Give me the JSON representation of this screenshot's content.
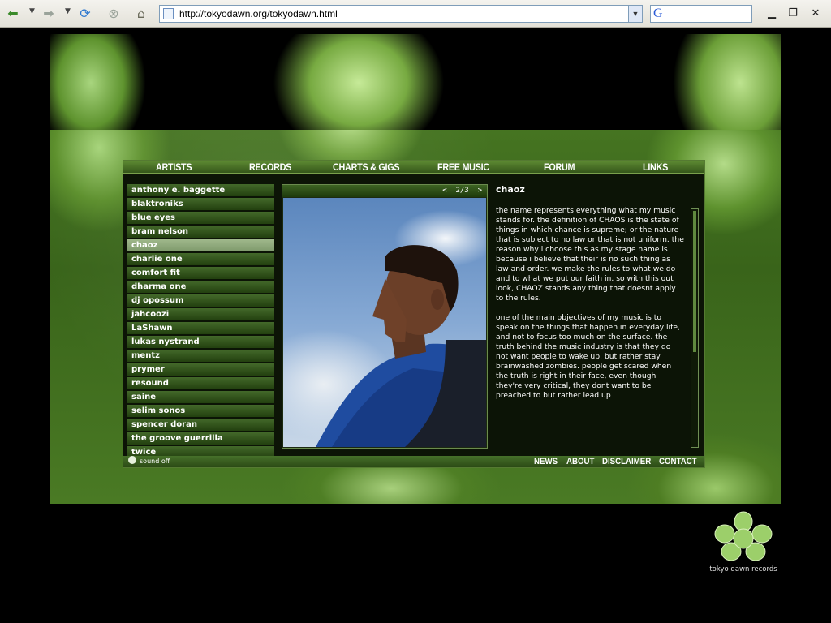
{
  "browser": {
    "url": "http://tokyodawn.org/tokyodawn.html",
    "search_logo": "G"
  },
  "nav": [
    "ARTISTS",
    "RECORDS",
    "CHARTS & GIGS",
    "FREE MUSIC",
    "FORUM",
    "LINKS"
  ],
  "artists": [
    "anthony e. baggette",
    "blaktroniks",
    "blue eyes",
    "bram nelson",
    "chaoz",
    "charlie one",
    "comfort fit",
    "dharma one",
    "dj opossum",
    "jahcoozi",
    "LaShawn",
    "lukas nystrand",
    "mentz",
    "prymer",
    "resound",
    "saine",
    "selim sonos",
    "spencer doran",
    "the groove guerrilla",
    "twice"
  ],
  "active_artist_index": 4,
  "photo": {
    "prev": "<",
    "counter": "2/3",
    "next": ">"
  },
  "artist": {
    "name": "chaoz",
    "para1": " the name represents everything what my music stands for. the definition of CHAOS is the state of things in which chance is supreme; or the nature that is subject to no law or that is not uniform. the reason why i choose this as my stage name is because i believe that their is no such thing as law and order. we make the rules to what we do and to what we put our faith in. so with this out look, CHAOZ stands any thing that doesnt apply to the rules.",
    "para2": " one of the main objectives of my music is to speak on the things that happen in everyday life, and not to focus too much on the surface. the truth behind the music industry is that they do not want people to wake up, but rather stay brainwashed zombies. people get scared when the truth is right in their face, even though they're very critical, they dont want to be preached to but rather lead up"
  },
  "sound": "sound off",
  "footer": [
    "NEWS",
    "ABOUT",
    "DISCLAIMER",
    "CONTACT"
  ],
  "logo_text": "tokyo dawn records",
  "colors": {
    "nav_green": "#4a7526",
    "active_item": "#8faa7a",
    "background": "#000000"
  }
}
